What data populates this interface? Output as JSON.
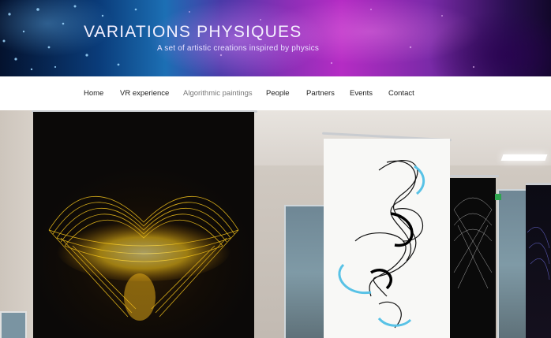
{
  "site": {
    "title": "VARIATIONS PHYSIQUES",
    "tagline": "A set of artistic creations inspired by physics"
  },
  "nav": {
    "items": [
      {
        "label": "Home",
        "active": false
      },
      {
        "label": "VR experience",
        "active": false
      },
      {
        "label": "Algorithmic paintings",
        "active": true
      },
      {
        "label": "People",
        "active": false
      },
      {
        "label": "Partners",
        "active": false
      },
      {
        "label": "Events",
        "active": false
      },
      {
        "label": "Contact",
        "active": false
      }
    ]
  },
  "colors": {
    "header_blue": "#1c6fb4",
    "header_magenta": "#b52cc4",
    "nav_text": "#222222",
    "nav_active": "#777777"
  }
}
